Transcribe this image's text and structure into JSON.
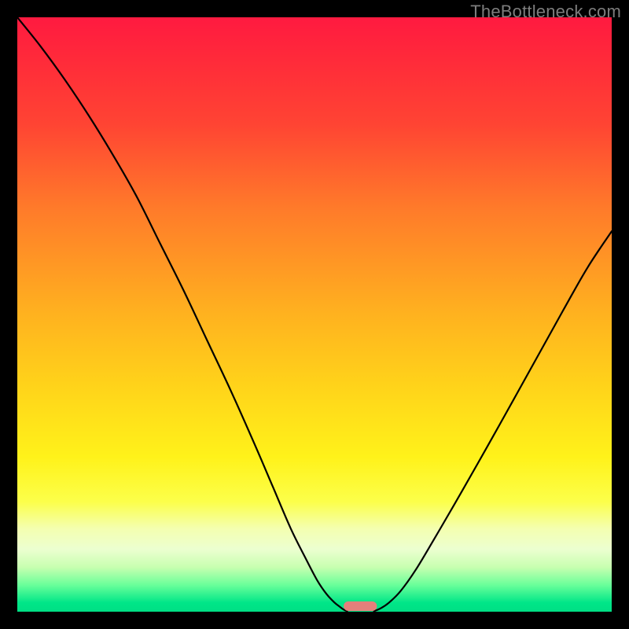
{
  "watermark": "TheBottleneck.com",
  "accent_marker_color": "#e47f7b",
  "curve_color": "#000000",
  "chart_data": {
    "type": "line",
    "title": "",
    "xlabel": "",
    "ylabel": "",
    "xlim": [
      0,
      100
    ],
    "ylim": [
      0,
      100
    ],
    "gradient_stops": [
      {
        "offset": 0.0,
        "color": "#ff1a40"
      },
      {
        "offset": 0.07,
        "color": "#ff2a3a"
      },
      {
        "offset": 0.18,
        "color": "#ff4433"
      },
      {
        "offset": 0.32,
        "color": "#ff7a2a"
      },
      {
        "offset": 0.5,
        "color": "#ffb21f"
      },
      {
        "offset": 0.62,
        "color": "#ffd31a"
      },
      {
        "offset": 0.74,
        "color": "#fff21a"
      },
      {
        "offset": 0.815,
        "color": "#fcff4a"
      },
      {
        "offset": 0.86,
        "color": "#f4ffb0"
      },
      {
        "offset": 0.895,
        "color": "#ecffd0"
      },
      {
        "offset": 0.925,
        "color": "#c8ffb0"
      },
      {
        "offset": 0.955,
        "color": "#6aff9a"
      },
      {
        "offset": 0.985,
        "color": "#00e688"
      },
      {
        "offset": 1.0,
        "color": "#00df84"
      }
    ],
    "series": [
      {
        "name": "left_curve",
        "x": [
          0,
          4,
          8,
          12,
          16,
          20,
          24,
          28,
          32,
          36,
          40,
          43,
          46,
          48.5,
          50.5,
          52,
          53.3,
          54.3,
          55,
          55.5
        ],
        "y": [
          100,
          95,
          89.5,
          83.5,
          77,
          70,
          62,
          54,
          45.5,
          37,
          28,
          21,
          14,
          9,
          5.2,
          3,
          1.6,
          0.8,
          0.3,
          0.1
        ]
      },
      {
        "name": "right_curve",
        "x": [
          60,
          61,
          62.5,
          64.5,
          67,
          70,
          73.5,
          77.5,
          82,
          87,
          92,
          96,
          100
        ],
        "y": [
          0.1,
          0.5,
          1.5,
          3.5,
          7,
          12,
          18,
          25,
          33,
          42,
          51,
          58,
          64
        ]
      }
    ],
    "marker": {
      "x_center": 57.7,
      "width": 5.6,
      "height_ratio": 0.016
    }
  }
}
